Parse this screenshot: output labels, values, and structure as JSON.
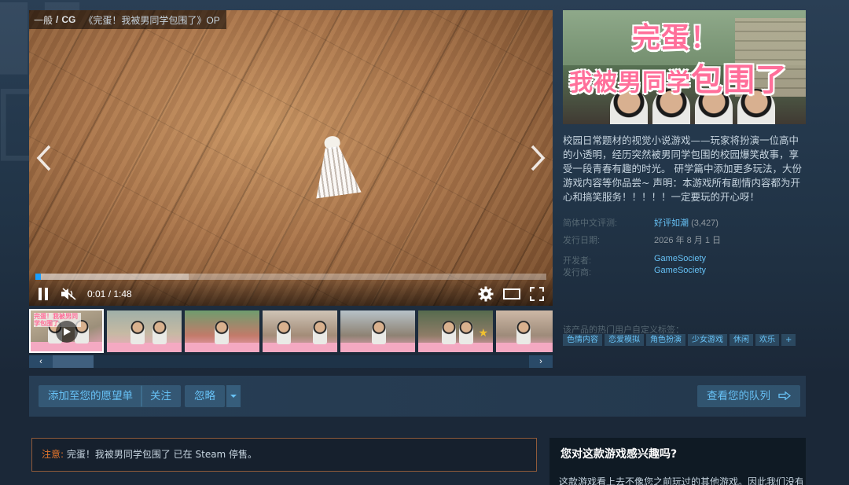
{
  "breadcrumb": {
    "category": "一般",
    "separator": "/",
    "type": "CG",
    "video_title": "《完蛋！我被男同学包围了》OP"
  },
  "player": {
    "time": "0:01 / 1:48",
    "progress": 0.01,
    "buffered": 0.3
  },
  "capsule": {
    "logo_line1": "完蛋！",
    "logo_line2_part1": "我被男同学",
    "logo_line2_part2": "包围了"
  },
  "game": {
    "description": "校园日常题材的视觉小说游戏——玩家将扮演一位高中的小透明，经历突然被男同学包围的校园爆笑故事，享受一段青春有趣的时光。 研学篇中添加更多玩法，大份游戏内容等你品尝~ 声明：本游戏所有剧情内容都为开心和搞笑服务！！！！！一定要玩的开心呀！"
  },
  "info": {
    "review_label": "简体中文评测:",
    "review_value": "好评如潮",
    "review_count": "(3,427)",
    "release_label": "发行日期:",
    "release_value": "2026 年 8 月 1 日",
    "developer_label": "开发者:",
    "developer_value": "GameSociety",
    "publisher_label": "发行商:",
    "publisher_value": "GameSociety"
  },
  "tags": {
    "label": "该产品的热门用户自定义标签：",
    "items": [
      "色情内容",
      "恋爱模拟",
      "角色扮演",
      "少女游戏",
      "休闲",
      "欢乐",
      "+"
    ]
  },
  "thumbnails": {
    "scroll_left": "‹",
    "scroll_right": "›",
    "thumb0_text": "完蛋！我被男同学包围了"
  },
  "actions": {
    "wishlist": "添加至您的愿望单",
    "follow": "关注",
    "ignore": "忽略",
    "queue": "查看您的队列"
  },
  "notice": {
    "warn": "注意:",
    "text": " 完蛋！我被男同学包围了 已在 Steam 停售。"
  },
  "interest": {
    "heading": "您对这款游戏感兴趣吗?",
    "body": "这款游戏看上去不像您之前玩过的其他游戏。因此我们没有"
  },
  "colors": {
    "background": "#1b2838",
    "link": "#66c0f4",
    "accent_progress": "#1a9fff",
    "tag_text": "#67c1f5",
    "warning": "#e6752b",
    "logo_pink": "#ff6f9a"
  }
}
